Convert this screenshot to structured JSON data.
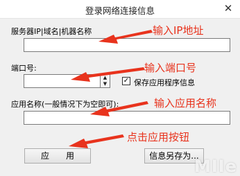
{
  "window": {
    "title": "登录网络连接信息",
    "close_glyph": "✕"
  },
  "form": {
    "server_label": "服务器IP|域名|机器名称",
    "server_value": "",
    "port_label": "端口号:",
    "port_value": "",
    "save_app_label": "保存应用程序信息",
    "save_app_checked": true,
    "app_name_label": "应用名称(一般情况下为空即可):",
    "app_name_value": ""
  },
  "buttons": {
    "apply": "应　　用",
    "save_as": "信息另存为..."
  },
  "annotations": {
    "server_hint": "输入IP地址",
    "port_hint": "输入端口号",
    "app_hint": "输入应用名称",
    "apply_hint": "点击应用按钮",
    "color": "#e8331d"
  },
  "watermark": "MIIe"
}
